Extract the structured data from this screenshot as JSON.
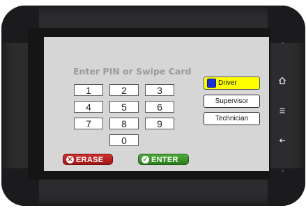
{
  "pin_panel": {
    "title": "Enter PIN or Swipe Card",
    "keys": [
      "1",
      "2",
      "3",
      "4",
      "5",
      "6",
      "7",
      "8",
      "9",
      "0"
    ]
  },
  "roles": [
    {
      "label": "Driver",
      "selected": true
    },
    {
      "label": "Supervisor",
      "selected": false
    },
    {
      "label": "Technician",
      "selected": false
    }
  ],
  "actions": {
    "erase_label": "ERASE",
    "enter_label": "ENTER"
  },
  "side_nav": {
    "home_icon": "home-outline-icon",
    "menu_icon": "menu-lines-icon",
    "back_icon": "back-arrow-icon"
  },
  "colors": {
    "selected_role": "#ffff00",
    "driver_swatch": "#1630d8",
    "erase": "#c02020",
    "enter": "#3a9a2a"
  }
}
